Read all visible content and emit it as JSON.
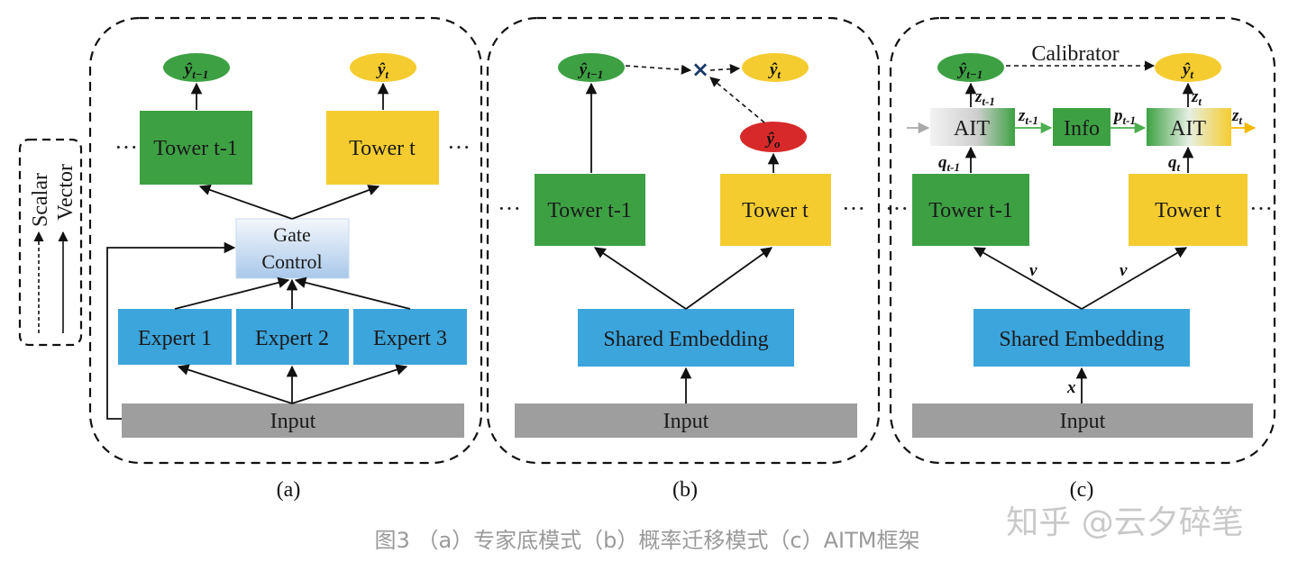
{
  "legend": {
    "scalar": "Scalar",
    "vector": "Vector"
  },
  "panel_a": {
    "y_prev": "ŷ",
    "y_prev_sub": "t−1",
    "y_cur": "ŷ",
    "y_cur_sub": "t",
    "tower_prev": "Tower t-1",
    "tower_cur": "Tower t",
    "gate_line1": "Gate",
    "gate_line2": "Control",
    "experts": [
      "Expert 1",
      "Expert 2",
      "Expert 3"
    ],
    "input": "Input",
    "label": "(a)"
  },
  "panel_b": {
    "y_prev": "ŷ",
    "y_prev_sub": "t−1",
    "y_cur": "ŷ",
    "y_cur_sub": "t",
    "y_o": "ŷ",
    "y_o_sub": "o",
    "multiply": "×",
    "tower_prev": "Tower t-1",
    "tower_cur": "Tower t",
    "shared": "Shared Embedding",
    "input": "Input",
    "label": "(b)"
  },
  "panel_c": {
    "calibrator": "Calibrator",
    "y_prev": "ŷ",
    "y_prev_sub": "t−1",
    "y_cur": "ŷ",
    "y_cur_sub": "t",
    "ait_left": "AIT",
    "ait_right": "AIT",
    "info": "Info",
    "z_prev_up": "z",
    "z_prev_up_sub": "t-1",
    "z_cur_up": "z",
    "z_cur_up_sub": "t",
    "z_mid": "z",
    "z_mid_sub": "t-1",
    "p_mid": "p",
    "p_mid_sub": "t-1",
    "z_out": "z",
    "z_out_sub": "t",
    "q_left": "q",
    "q_left_sub": "t-1",
    "q_right": "q",
    "q_right_sub": "t",
    "tower_prev": "Tower t-1",
    "tower_cur": "Tower t",
    "v_left": "v",
    "v_right": "v",
    "shared": "Shared Embedding",
    "x": "x",
    "input": "Input",
    "label": "(c)"
  },
  "ellipsis": "···",
  "caption": "图3 （a）专家底模式（b）概率迁移模式（c）AITM框架",
  "watermark": "知乎 @云夕碎笔",
  "colors": {
    "green": "#3da143",
    "yellow": "#f5cc30",
    "blue": "#3ca5dc",
    "gray": "#9e9e9e",
    "red": "#d8292a"
  }
}
